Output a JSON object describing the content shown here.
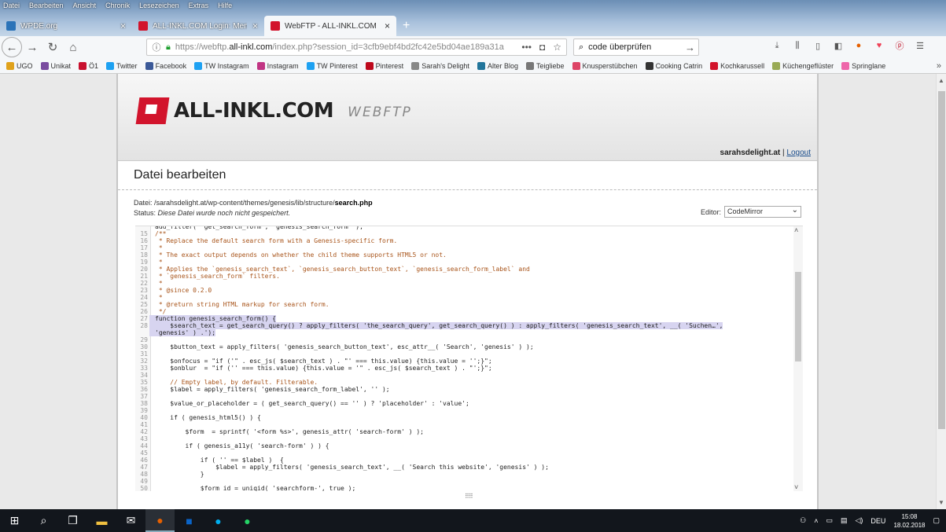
{
  "menubar": [
    "Datei",
    "Bearbeiten",
    "Ansicht",
    "Chronik",
    "Lesezeichen",
    "Extras",
    "Hilfe"
  ],
  "tabs": [
    {
      "label": "WPDE.org",
      "color": "#2b73b8",
      "active": false
    },
    {
      "label": "ALL-INKL.COM Login: Memb",
      "color": "#d2142c",
      "active": false
    },
    {
      "label": "WebFTP - ALL-INKL.COM",
      "color": "#d2142c",
      "active": true
    }
  ],
  "navbar": {
    "url_prefix": "https://webftp.",
    "url_domain": "all-inkl.com",
    "url_rest": "/index.php?session_id=3cfb9ebf4bd2fc42e5bd04ae189a31a",
    "search_value": "code überprüfen"
  },
  "bookmarks": [
    {
      "label": "UGO",
      "color": "#e0a21c"
    },
    {
      "label": "Unikat",
      "color": "#7a4ca0"
    },
    {
      "label": "Ö1",
      "color": "#c8102e"
    },
    {
      "label": "Twitter",
      "color": "#1da1f2"
    },
    {
      "label": "Facebook",
      "color": "#3b5998"
    },
    {
      "label": "TW Instagram",
      "color": "#1da1f2"
    },
    {
      "label": "Instagram",
      "color": "#c13584"
    },
    {
      "label": "TW Pinterest",
      "color": "#1da1f2"
    },
    {
      "label": "Pinterest",
      "color": "#bd081c"
    },
    {
      "label": "Sarah's Delight",
      "color": "#888888"
    },
    {
      "label": "Alter Blog",
      "color": "#21759b"
    },
    {
      "label": "Teigliebe",
      "color": "#777777"
    },
    {
      "label": "Knusperstübchen",
      "color": "#d46"
    },
    {
      "label": "Cooking Catrin",
      "color": "#333333"
    },
    {
      "label": "Kochkarussell",
      "color": "#d2142c"
    },
    {
      "label": "Küchengeflüster",
      "color": "#9a5"
    },
    {
      "label": "Springlane",
      "color": "#e6a"
    }
  ],
  "header": {
    "logo_name": "ALL-INKL.COM",
    "logo_sub": "WEBFTP",
    "user": "sarahsdelight.at",
    "separator": " | ",
    "logout": "Logout"
  },
  "page_title": "Datei bearbeiten",
  "fileinfo": {
    "file_label": "Datei: ",
    "file_path": "/sarahsdelight.at/wp-content/themes/genesis/lib/structure/",
    "file_name": "search.php",
    "status_label": "Status: ",
    "status_text": "Diese Datei wurde noch nicht gespeichert."
  },
  "editor_select": {
    "label": "Editor:",
    "value": "CodeMirror"
  },
  "code": [
    {
      "n": "",
      "t": "add_filter( 'get_search_form', 'genesis_search_form' );",
      "c": ""
    },
    {
      "n": "15",
      "t": "/**",
      "c": "cm"
    },
    {
      "n": "16",
      "t": " * Replace the default search form with a Genesis-specific form.",
      "c": "cm"
    },
    {
      "n": "17",
      "t": " *",
      "c": "cm"
    },
    {
      "n": "18",
      "t": " * The exact output depends on whether the child theme supports HTML5 or not.",
      "c": "cm"
    },
    {
      "n": "19",
      "t": " *",
      "c": "cm"
    },
    {
      "n": "20",
      "t": " * Applies the `genesis_search_text`, `genesis_search_button_text`, `genesis_search_form_label` and",
      "c": "cm"
    },
    {
      "n": "21",
      "t": " * `genesis_search_form` filters.",
      "c": "cm"
    },
    {
      "n": "22",
      "t": " *",
      "c": "cm"
    },
    {
      "n": "23",
      "t": " * @since 0.2.0",
      "c": "cm"
    },
    {
      "n": "24",
      "t": " *",
      "c": "cm"
    },
    {
      "n": "25",
      "t": " * @return string HTML markup for search form.",
      "c": "cm"
    },
    {
      "n": "26",
      "t": " */",
      "c": "cm"
    },
    {
      "n": "27",
      "t": "function genesis_search_form() {",
      "c": "hl"
    },
    {
      "n": "28",
      "t": "    $search_text = get_search_query() ? apply_filters( 'the_search_query', get_search_query() ) : apply_filters( 'genesis_search_text', __( 'Suchen…',",
      "c": "hl"
    },
    {
      "n": "",
      "t": "'genesis' ) .');",
      "c": "hl"
    },
    {
      "n": "29",
      "t": "",
      "c": ""
    },
    {
      "n": "30",
      "t": "    $button_text = apply_filters( 'genesis_search_button_text', esc_attr__( 'Search', 'genesis' ) );",
      "c": ""
    },
    {
      "n": "31",
      "t": "",
      "c": ""
    },
    {
      "n": "32",
      "t": "    $onfocus = \"if ('\" . esc_js( $search_text ) . \"' === this.value) {this.value = '';}\";",
      "c": ""
    },
    {
      "n": "33",
      "t": "    $onblur  = \"if ('' === this.value) {this.value = '\" . esc_js( $search_text ) . \"';}\";",
      "c": ""
    },
    {
      "n": "34",
      "t": "",
      "c": ""
    },
    {
      "n": "35",
      "t": "    // Empty label, by default. Filterable.",
      "c": "cm"
    },
    {
      "n": "36",
      "t": "    $label = apply_filters( 'genesis_search_form_label', '' );",
      "c": ""
    },
    {
      "n": "37",
      "t": "",
      "c": ""
    },
    {
      "n": "38",
      "t": "    $value_or_placeholder = ( get_search_query() == '' ) ? 'placeholder' : 'value';",
      "c": ""
    },
    {
      "n": "39",
      "t": "",
      "c": ""
    },
    {
      "n": "40",
      "t": "    if ( genesis_html5() ) {",
      "c": ""
    },
    {
      "n": "41",
      "t": "",
      "c": ""
    },
    {
      "n": "42",
      "t": "        $form  = sprintf( '<form %s>', genesis_attr( 'search-form' ) );",
      "c": ""
    },
    {
      "n": "43",
      "t": "",
      "c": ""
    },
    {
      "n": "44",
      "t": "        if ( genesis_a11y( 'search-form' ) ) {",
      "c": ""
    },
    {
      "n": "45",
      "t": "",
      "c": ""
    },
    {
      "n": "46",
      "t": "            if ( '' == $label )  {",
      "c": ""
    },
    {
      "n": "47",
      "t": "                $label = apply_filters( 'genesis_search_text', __( 'Search this website', 'genesis' ) );",
      "c": ""
    },
    {
      "n": "48",
      "t": "            }",
      "c": ""
    },
    {
      "n": "49",
      "t": "",
      "c": ""
    },
    {
      "n": "50",
      "t": "            $form_id = uniqid( 'searchform-', true );",
      "c": ""
    }
  ],
  "taskbar": {
    "lang": "DEU",
    "time": "15:08",
    "date": "18.02.2018"
  }
}
